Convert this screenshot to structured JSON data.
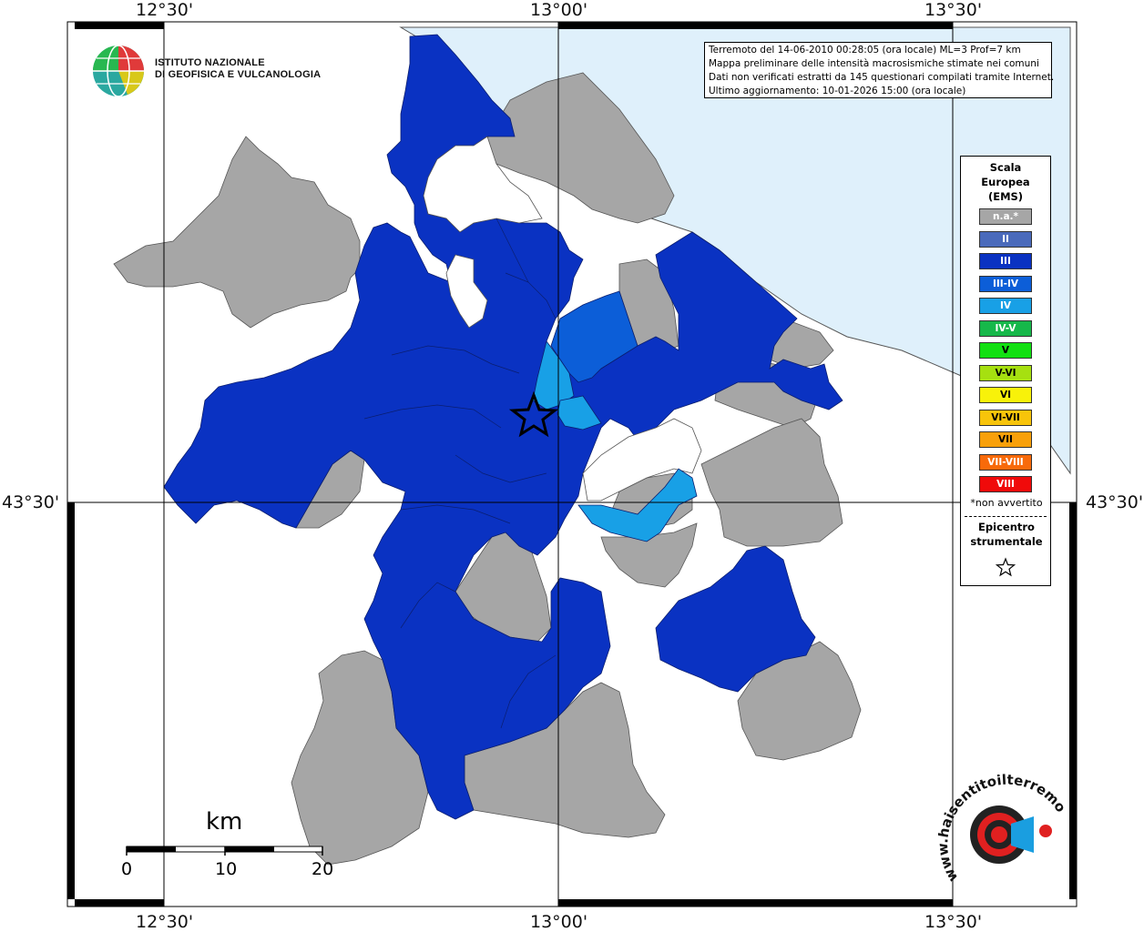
{
  "coords": {
    "top": [
      "12°30'",
      "13°00'",
      "13°30'"
    ],
    "bottom": [
      "12°30'",
      "13°00'",
      "13°30'"
    ],
    "left": "43°30'",
    "right": "43°30'"
  },
  "logo": {
    "line1": "ISTITUTO NAZIONALE",
    "line2": "DI GEOFISICA E VULCANOLOGIA",
    "icon": "ingv-globe-icon"
  },
  "info": {
    "line1": "Terremoto del 14-06-2010 00:28:05 (ora locale) ML=3 Prof=7 km",
    "line2": "Mappa preliminare delle intensità macrosismiche stimate nei comuni",
    "line3": "Dati non verificati estratti da 145 questionari compilati tramite Internet.",
    "line4": "Ultimo aggiornamento: 10-01-2026 15:00 (ora locale)"
  },
  "legend": {
    "title1": "Scala",
    "title2": "Europea",
    "title3": "(EMS)",
    "items": [
      {
        "label": "n.a.*",
        "color": "#a6a6a6"
      },
      {
        "label": "II",
        "color": "#4a6abb"
      },
      {
        "label": "III",
        "color": "#0a32c2"
      },
      {
        "label": "III-IV",
        "color": "#0c5ed8"
      },
      {
        "label": "IV",
        "color": "#18a0e6"
      },
      {
        "label": "IV-V",
        "color": "#16b84a"
      },
      {
        "label": "V",
        "color": "#12e012"
      },
      {
        "label": "V-VI",
        "color": "#a6e010"
      },
      {
        "label": "VI",
        "color": "#f8f20a"
      },
      {
        "label": "VI-VII",
        "color": "#f8c40a"
      },
      {
        "label": "VII",
        "color": "#f8a00a"
      },
      {
        "label": "VII-VIII",
        "color": "#f86a0a"
      },
      {
        "label": "VIII",
        "color": "#f00a0a"
      }
    ],
    "note": "*non avvertito",
    "epicenter1": "Epicentro",
    "epicenter2": "strumentale",
    "epicenter_icon": "star-icon"
  },
  "scalebar": {
    "unit": "km",
    "ticks": [
      "0",
      "10",
      "20"
    ]
  },
  "watermark": {
    "text": "www.haisentitoilterremoto.it",
    "icon": "seismograph-target-icon"
  },
  "colors": {
    "sea": "#dff0fb",
    "na": "#a6a6a6",
    "III": "#0a32c2",
    "III-IV": "#0c5ed8",
    "IV": "#18a0e6"
  }
}
